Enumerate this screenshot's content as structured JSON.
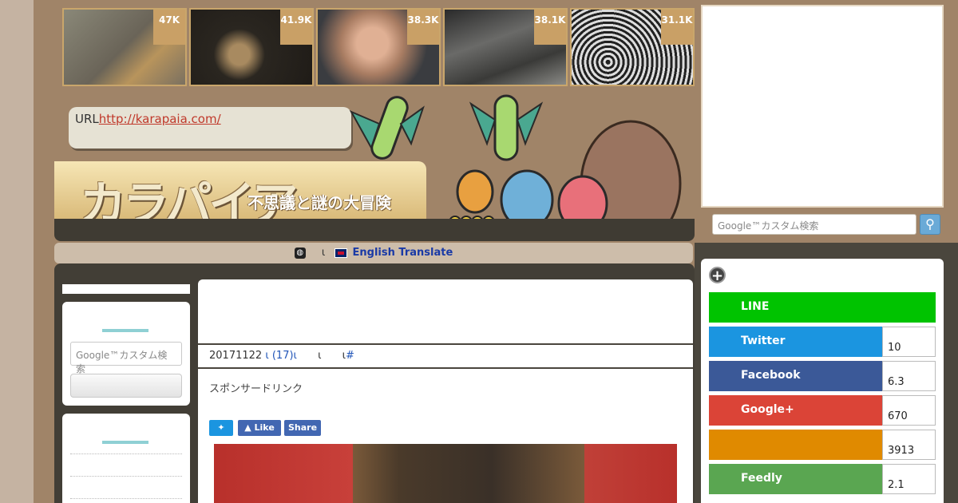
{
  "thumbs": [
    {
      "count": "47K",
      "name": "thumb-cat-cage",
      "bg": "#7a7568"
    },
    {
      "count": "41.9K",
      "name": "thumb-child-dark",
      "bg": "#3a3430"
    },
    {
      "count": "38.3K",
      "name": "thumb-man-crying",
      "bg": "#a87c62"
    },
    {
      "count": "38.1K",
      "name": "thumb-cctv",
      "bg": "#4a4a48"
    },
    {
      "count": "31.1K",
      "name": "thumb-illustration",
      "bg": "#d8d4cc"
    }
  ],
  "header": {
    "url_label": "URL",
    "url_link": "http://karapaia.com/",
    "logo_text": "カラパイア",
    "logo_sub": "不思議と謎の大冒険"
  },
  "translate": {
    "sep": "ι",
    "label": "English Translate"
  },
  "search": {
    "placeholder": "Google™カスタム検索"
  },
  "article": {
    "title": "",
    "meta_date": "20171122",
    "meta_sep": "ι",
    "meta_comments": "(17)",
    "meta_sep2": "ι",
    "meta_sep3": "ι",
    "meta_sep4": "ι",
    "meta_hash": "#",
    "sponsor": "スポンサードリンク"
  },
  "share_buttons": {
    "like": "Like",
    "share": "Share"
  },
  "social": [
    {
      "label": "LINE",
      "count": "",
      "color": "#00c300"
    },
    {
      "label": "Twitter",
      "count": "10",
      "color": "#1b95e0"
    },
    {
      "label": "Facebook",
      "count": "6.3",
      "color": "#3b5998"
    },
    {
      "label": "Google+",
      "count": "670",
      "color": "#db4437"
    },
    {
      "label": "",
      "count": "3913",
      "color": "#e08a00"
    },
    {
      "label": "Feedly",
      "count": "2.1",
      "color": "#5aa651"
    }
  ]
}
